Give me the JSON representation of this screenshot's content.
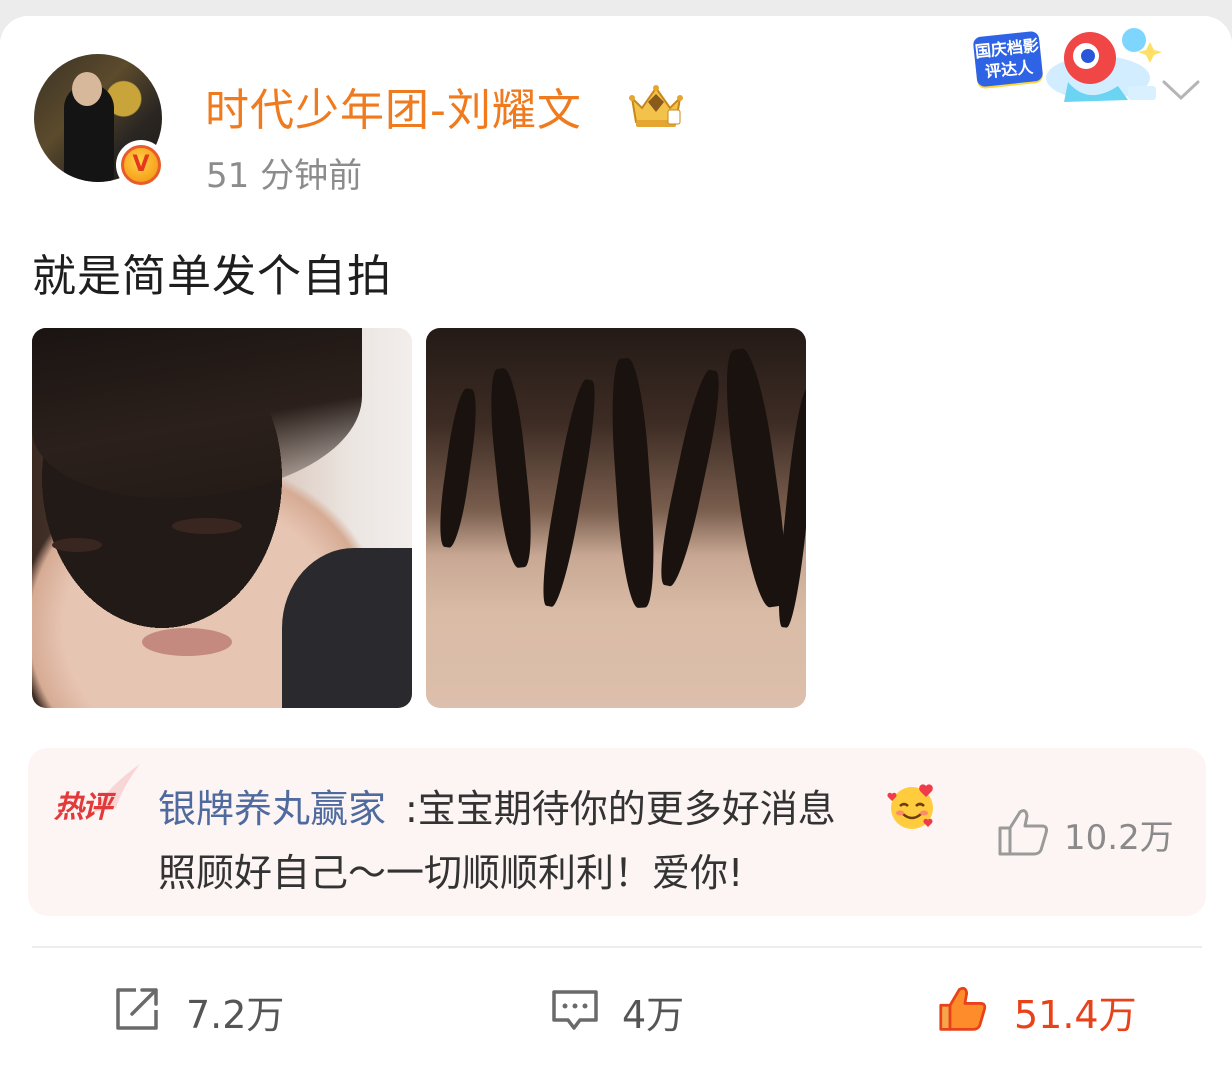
{
  "post": {
    "author": "时代少年团-刘耀文",
    "time": "51 分钟前",
    "text": "就是简单发个自拍",
    "verified_badge": "V",
    "event_badge": "国庆档影评达人",
    "images": [
      "selfie-1",
      "selfie-2"
    ]
  },
  "hot_comment": {
    "tag": "热评",
    "author": "银牌养丸赢家",
    "text_line1": ":宝宝期待你的更多好消息",
    "text_line2": "照顾好自己～一切顺顺利利！爱你!",
    "likes": "10.2万"
  },
  "actions": {
    "repost": "7.2万",
    "comments": "4万",
    "likes": "51.4万"
  },
  "colors": {
    "username": "#f07a1e",
    "comment_author": "#4e6a9e",
    "liked": "#e8421a",
    "hot_tag": "#e23a3a"
  },
  "icons": [
    "crown-icon",
    "chevron-down-icon",
    "thumbs-up-icon",
    "share-icon",
    "comment-icon",
    "smiling-hearts-emoji"
  ]
}
